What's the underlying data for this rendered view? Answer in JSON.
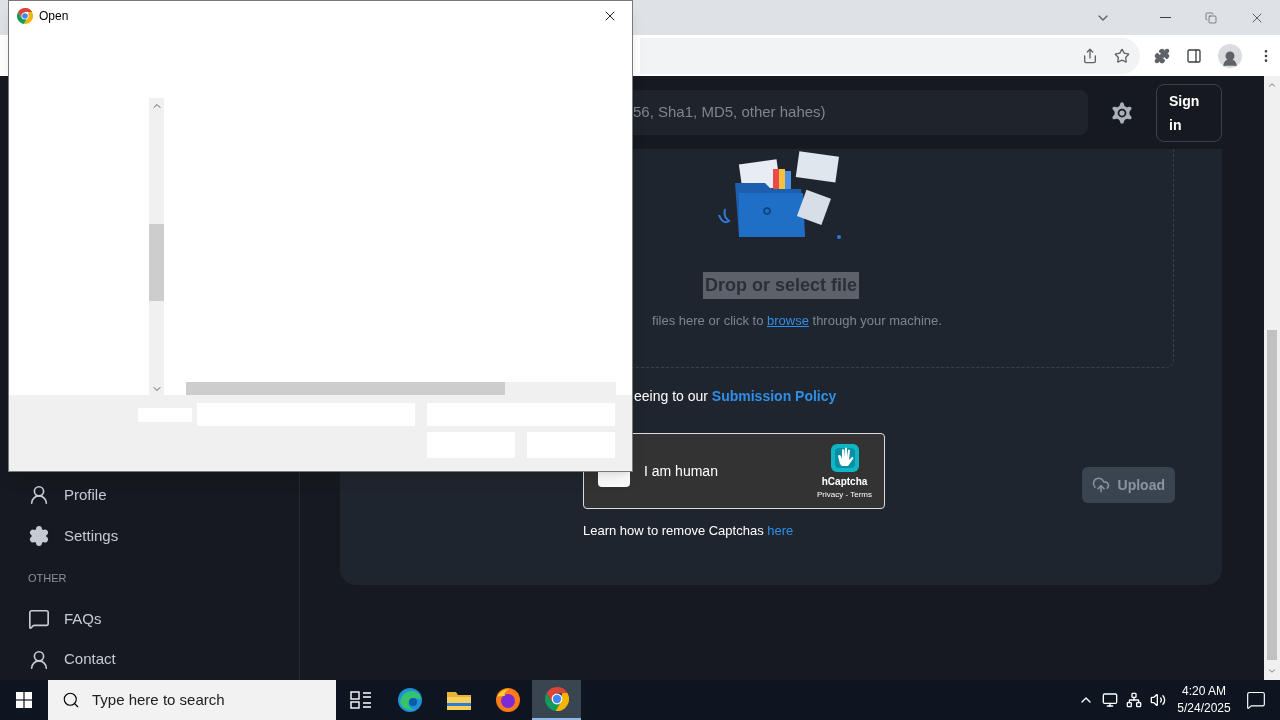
{
  "dialog": {
    "title": "Open"
  },
  "header": {
    "search": {
      "placeholder": "56, Sha1, MD5, other hahes)"
    },
    "sign_in": "Sign in"
  },
  "sidebar": {
    "items": [
      {
        "kind": "link",
        "label": "Profile"
      },
      {
        "kind": "link",
        "label": "Settings"
      },
      {
        "kind": "heading",
        "label": "OTHER"
      },
      {
        "kind": "link",
        "label": "FAQs"
      },
      {
        "kind": "link",
        "label": "Contact"
      }
    ]
  },
  "upload": {
    "title": "Drop or select file",
    "title_highlighted": true,
    "hint_start": "files here or click to",
    "hint_link": "browse",
    "hint_end": "through your machine.",
    "policy_text": "eeing to our",
    "policy_link": "Submission Policy",
    "captcha": {
      "label": "I am human",
      "brand": "hCaptcha",
      "links": "Privacy - Terms",
      "checked": false
    },
    "upload_button": {
      "label": "Upload",
      "disabled": true
    },
    "help_text": "Learn how to remove Captchas",
    "help_link": "here"
  },
  "taskbar": {
    "search_placeholder": "Type here to search",
    "apps": [
      {
        "kind": "taskview",
        "selected": false
      },
      {
        "kind": "edge",
        "selected": false
      },
      {
        "kind": "explorer",
        "selected": false
      },
      {
        "kind": "firefox",
        "selected": false
      },
      {
        "kind": "chrome",
        "selected": true
      }
    ],
    "time": "4:20 AM",
    "date": "5/24/2025"
  }
}
